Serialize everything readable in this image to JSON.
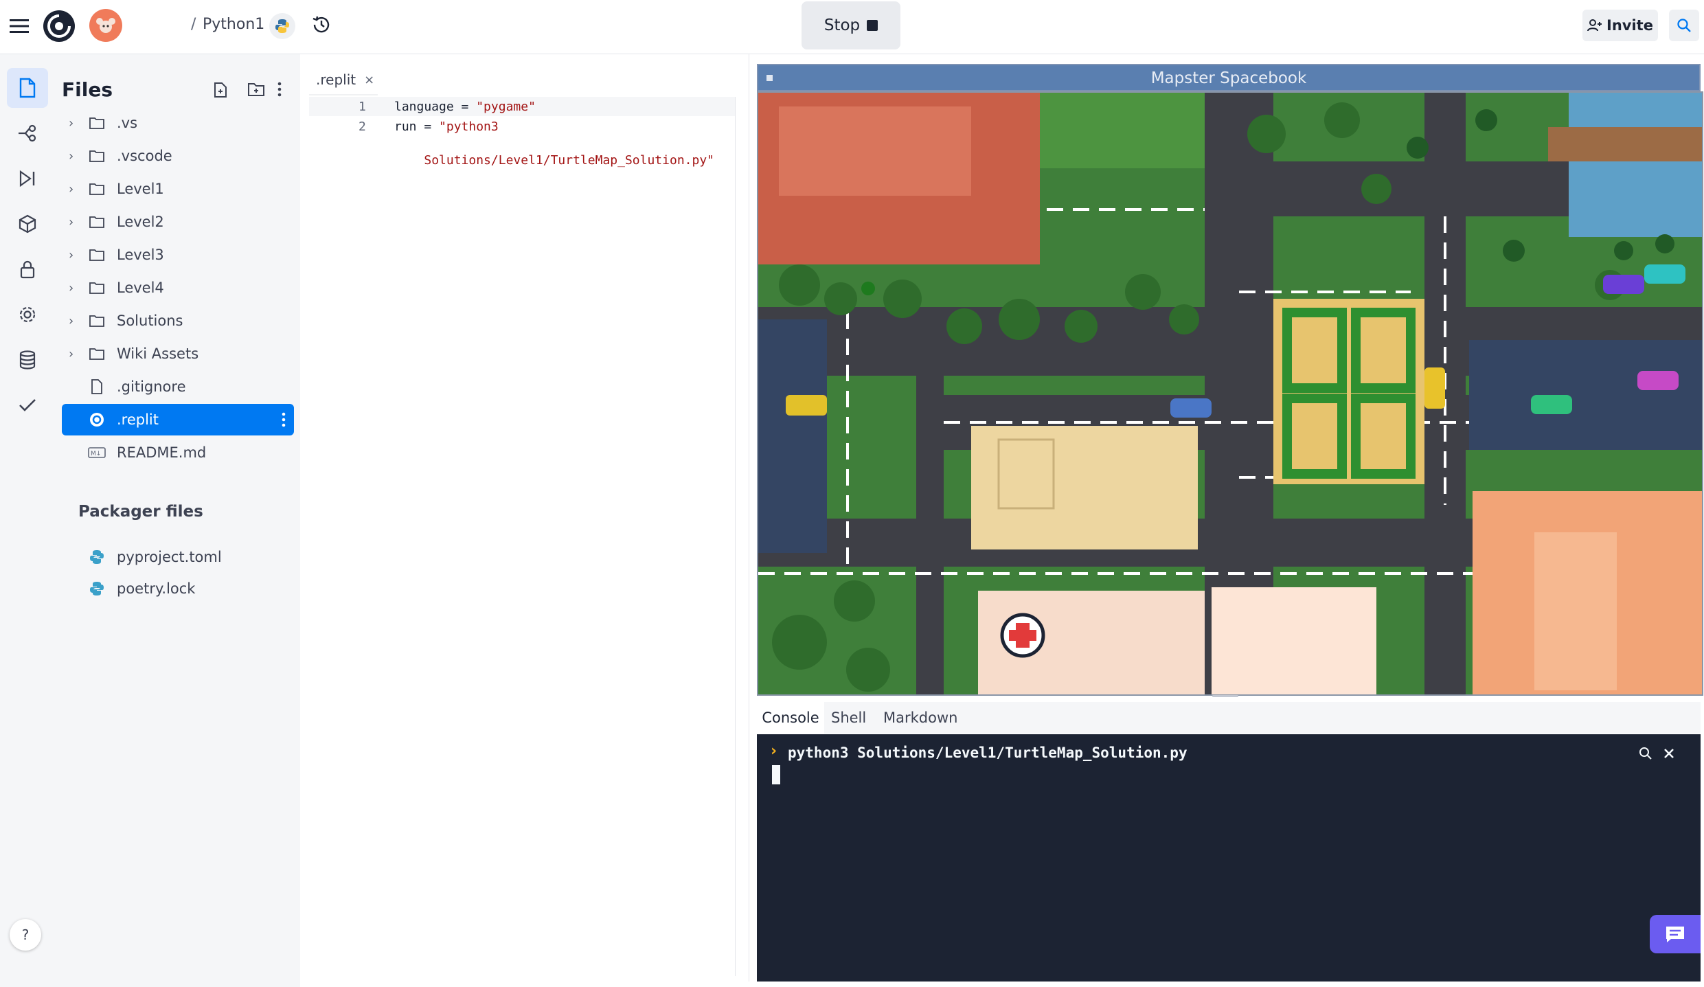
{
  "topbar": {
    "breadcrumb_sep": "/",
    "repl_name": "Python1",
    "stop_label": "Stop",
    "invite_label": "Invite"
  },
  "files": {
    "title": "Files",
    "items": [
      {
        "label": ".vs",
        "kind": "folder"
      },
      {
        "label": ".vscode",
        "kind": "folder"
      },
      {
        "label": "Level1",
        "kind": "folder"
      },
      {
        "label": "Level2",
        "kind": "folder"
      },
      {
        "label": "Level3",
        "kind": "folder"
      },
      {
        "label": "Level4",
        "kind": "folder"
      },
      {
        "label": "Solutions",
        "kind": "folder"
      },
      {
        "label": "Wiki Assets",
        "kind": "folder"
      },
      {
        "label": ".gitignore",
        "kind": "file"
      },
      {
        "label": ".replit",
        "kind": "file",
        "selected": true
      },
      {
        "label": "README.md",
        "kind": "markdown"
      }
    ],
    "packager_title": "Packager files",
    "packager_items": [
      "pyproject.toml",
      "poetry.lock"
    ]
  },
  "editor": {
    "tab_label": ".replit",
    "tab_close": "×",
    "lines": [
      {
        "num": "1",
        "key": "language",
        "eq": " = ",
        "val": "\"pygame\""
      },
      {
        "num": "2",
        "key": "run",
        "eq": " = ",
        "val": "\"python3"
      }
    ],
    "line2_cont": "Solutions/Level1/TurtleMap_Solution.py\""
  },
  "game": {
    "window_title": "Mapster Spacebook"
  },
  "console": {
    "tabs": [
      "Console",
      "Shell",
      "Markdown"
    ],
    "prompt": "›",
    "command": "python3 Solutions/Level1/TurtleMap_Solution.py"
  },
  "help_label": "?",
  "colors": {
    "accent": "#0079f2",
    "console_bg": "#1c2333",
    "prompt": "#f2b01e",
    "string": "#a31515",
    "chat_button": "#6b5cf0"
  }
}
